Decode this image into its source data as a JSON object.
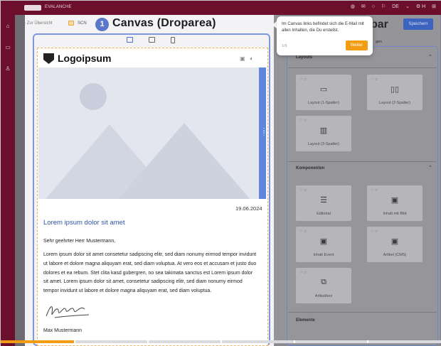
{
  "app": {
    "name": "EVALANCHE"
  },
  "topbar": {
    "language": "DE",
    "user_initial": "H"
  },
  "breadcrumb": {
    "back_label": "Zur Übersicht",
    "scn_label": "SCN"
  },
  "tour": {
    "step_number": "1",
    "step_title": "Canvas (Droparea)",
    "tooltip_text": "Im Canvas links befindet sich die E-Mail mit allen Inhalten, die Du erstellst.",
    "counter": "1/6",
    "next_label": "Weiter",
    "progress": 0.167
  },
  "email": {
    "logo_text": "Logoipsum",
    "date": "19.06.2024",
    "title": "Lorem ipsum dolor sit amet",
    "greeting": "Sehr geehrter Herr Mustermann,",
    "body": "Lorem ipsum dolor sit amet consetetur sadipscing elitr, sed diam nonumy eirmod tempor invidunt ut labore et dolore magna aliquyam erat, sed diam voluptua. At vero eos et accusam et justo duo dolores et ea rebum. Stet clita kasd gubergren, no sea takimata sanctus est Lorem ipsum dolor sit amet. Lorem ipsum dolor sit amet, consetetur sadipscing elitr, sed diam nonumy eirmod tempor invidunt ut labore et dolore magna aliquyam erat, sed diam voluptua.",
    "signature_name": "Max Mustermann"
  },
  "right_panel": {
    "title_fragment": "bar",
    "save_label": "Speichern",
    "header_fragment": "gen",
    "sections": {
      "layouts": "Layouts",
      "components": "Komponenten",
      "elements": "Elemente"
    },
    "layout_tiles": [
      "Layout (1-Spalter)",
      "Layout (2-Spalter)",
      "Layout (3-Spalter)"
    ],
    "component_tiles": [
      "Editorial",
      "Inhalt mit Bild",
      "Inhalt Event",
      "Artikel (CMS)",
      "Artikelbox"
    ]
  },
  "colors": {
    "brand": "#6b0f2c",
    "accent": "#f29c11",
    "highlight": "#5a77c9"
  }
}
